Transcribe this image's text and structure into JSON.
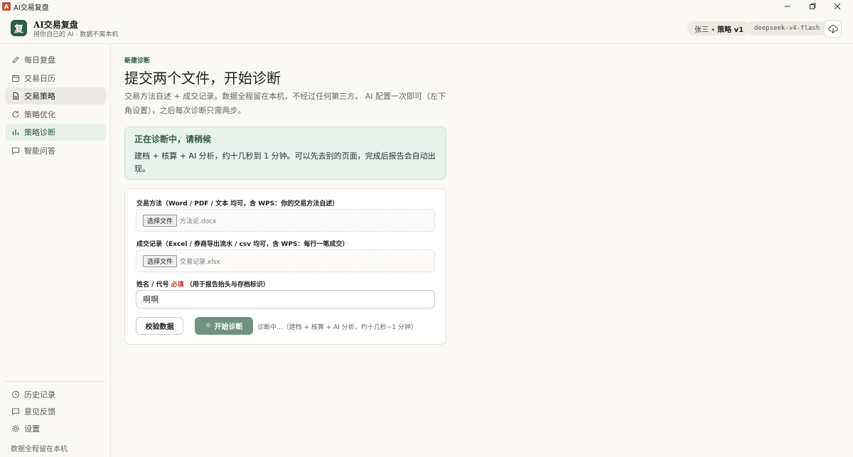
{
  "window": {
    "title": "AI交易复盘"
  },
  "header": {
    "brand_title": "AI交易复盘",
    "brand_sub": "用你自己的 AI · 数据不离本机",
    "logo_char": "复",
    "user_name": "张三 •",
    "strategy": "策略 v1",
    "model": "deepseek-v4-flash"
  },
  "sidebar": {
    "items": [
      {
        "label": "每日复盘",
        "icon": "pencil-icon"
      },
      {
        "label": "交易日历",
        "icon": "calendar-icon"
      },
      {
        "label": "交易策略",
        "icon": "document-icon"
      },
      {
        "label": "策略优化",
        "icon": "refresh-icon"
      },
      {
        "label": "策略诊断",
        "icon": "bar-chart-icon"
      },
      {
        "label": "智能问答",
        "icon": "chat-icon"
      }
    ],
    "bottom_items": [
      {
        "label": "历史记录",
        "icon": "clock-icon"
      },
      {
        "label": "意见反馈",
        "icon": "chat-icon"
      },
      {
        "label": "设置",
        "icon": "gear-icon"
      }
    ],
    "footer": "数据全程留在本机"
  },
  "main": {
    "eyebrow": "新建诊断",
    "title": "提交两个文件，开始诊断",
    "desc": "交易方法自述 + 成交记录。数据全程留在本机，不经过任何第三方。 AI 配置一次即可（左下角设置），之后每次诊断只需两步。",
    "status": {
      "title": "正在诊断中，请稍候",
      "text": "建档 + 核算 + AI 分析，约十几秒到 1 分钟。可以先去别的页面，完成后报告会自动出现。"
    },
    "form": {
      "method_label": "交易方法（Word / PDF / 文本 均可，含 WPS：你的交易方法自述）",
      "method_button": "选择文件",
      "method_file": "方法论.docx",
      "trades_label": "成交记录（Excel / 券商导出流水 / csv 均可，含 WPS：每行一笔成交）",
      "trades_button": "选择文件",
      "trades_file": "交易记录.xlsx",
      "name_label": "姓名 / 代号",
      "name_required": "必填",
      "name_hint": "（用于报告抬头与存档标识）",
      "name_value": "啊啊",
      "validate_button": "校验数据",
      "start_button": "开始诊断",
      "progress_hint": "诊断中...（建档 + 核算 + AI 分析，约十几秒~1 分钟）"
    }
  }
}
